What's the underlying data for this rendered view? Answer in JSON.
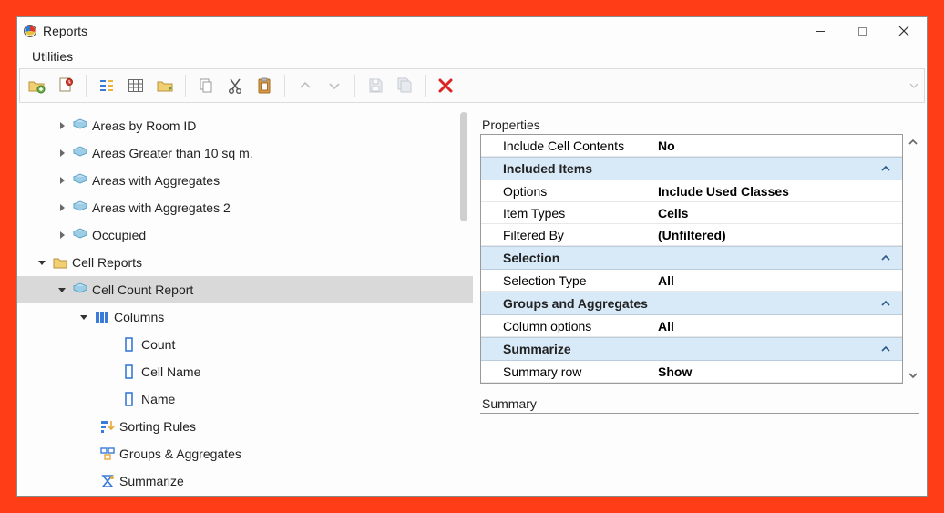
{
  "window": {
    "title": "Reports"
  },
  "menu": {
    "utilities": "Utilities"
  },
  "tree": {
    "areas_by_room_id": "Areas by Room ID",
    "areas_gt_10": "Areas Greater than 10 sq m.",
    "areas_agg": "Areas with Aggregates",
    "areas_agg2": "Areas with Aggregates 2",
    "occupied": "Occupied",
    "cell_reports": "Cell Reports",
    "cell_count_report": "Cell Count Report",
    "columns": "Columns",
    "col_count": "Count",
    "col_cell_name": "Cell Name",
    "col_name": "Name",
    "sorting_rules": "Sorting Rules",
    "groups_aggregates": "Groups & Aggregates",
    "summarize": "Summarize"
  },
  "panels": {
    "properties_label": "Properties",
    "summary_label": "Summary"
  },
  "props": {
    "top_row": {
      "k": "Include Cell Contents",
      "v": "No"
    },
    "included_items": {
      "header": "Included Items",
      "options": {
        "k": "Options",
        "v": "Include Used Classes"
      },
      "item_types": {
        "k": "Item Types",
        "v": "Cells"
      },
      "filtered_by": {
        "k": "Filtered By",
        "v": "(Unfiltered)"
      }
    },
    "selection": {
      "header": "Selection",
      "selection_type": {
        "k": "Selection Type",
        "v": "All"
      }
    },
    "groups_aggregates": {
      "header": "Groups and Aggregates",
      "column_options": {
        "k": "Column options",
        "v": "All"
      }
    },
    "summarize": {
      "header": "Summarize",
      "summary_row": {
        "k": "Summary row",
        "v": "Show"
      }
    }
  }
}
